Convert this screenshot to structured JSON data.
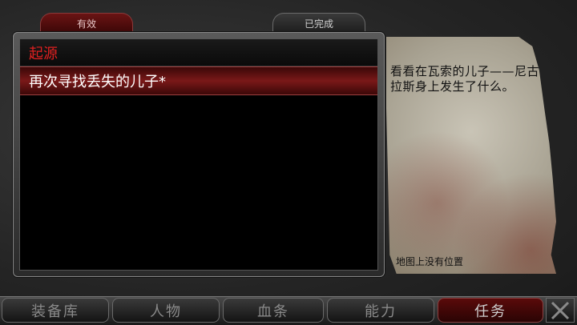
{
  "tabs": {
    "active_label": "有效",
    "completed_label": "已完成"
  },
  "quest_list": {
    "category": "起源",
    "items": [
      {
        "label": "再次寻找丢失的儿子*"
      }
    ]
  },
  "details": {
    "description": "看看在瓦索的儿子——尼古拉斯身上发生了什么。",
    "map_note": "地图上没有位置"
  },
  "nav": {
    "inventory": "装备库",
    "character": "人物",
    "health": "血条",
    "skills": "能力",
    "quests": "任务",
    "close_icon": "close-x-icon"
  },
  "colors": {
    "accent_red": "#e02020",
    "selected_row": "#7a1818"
  }
}
